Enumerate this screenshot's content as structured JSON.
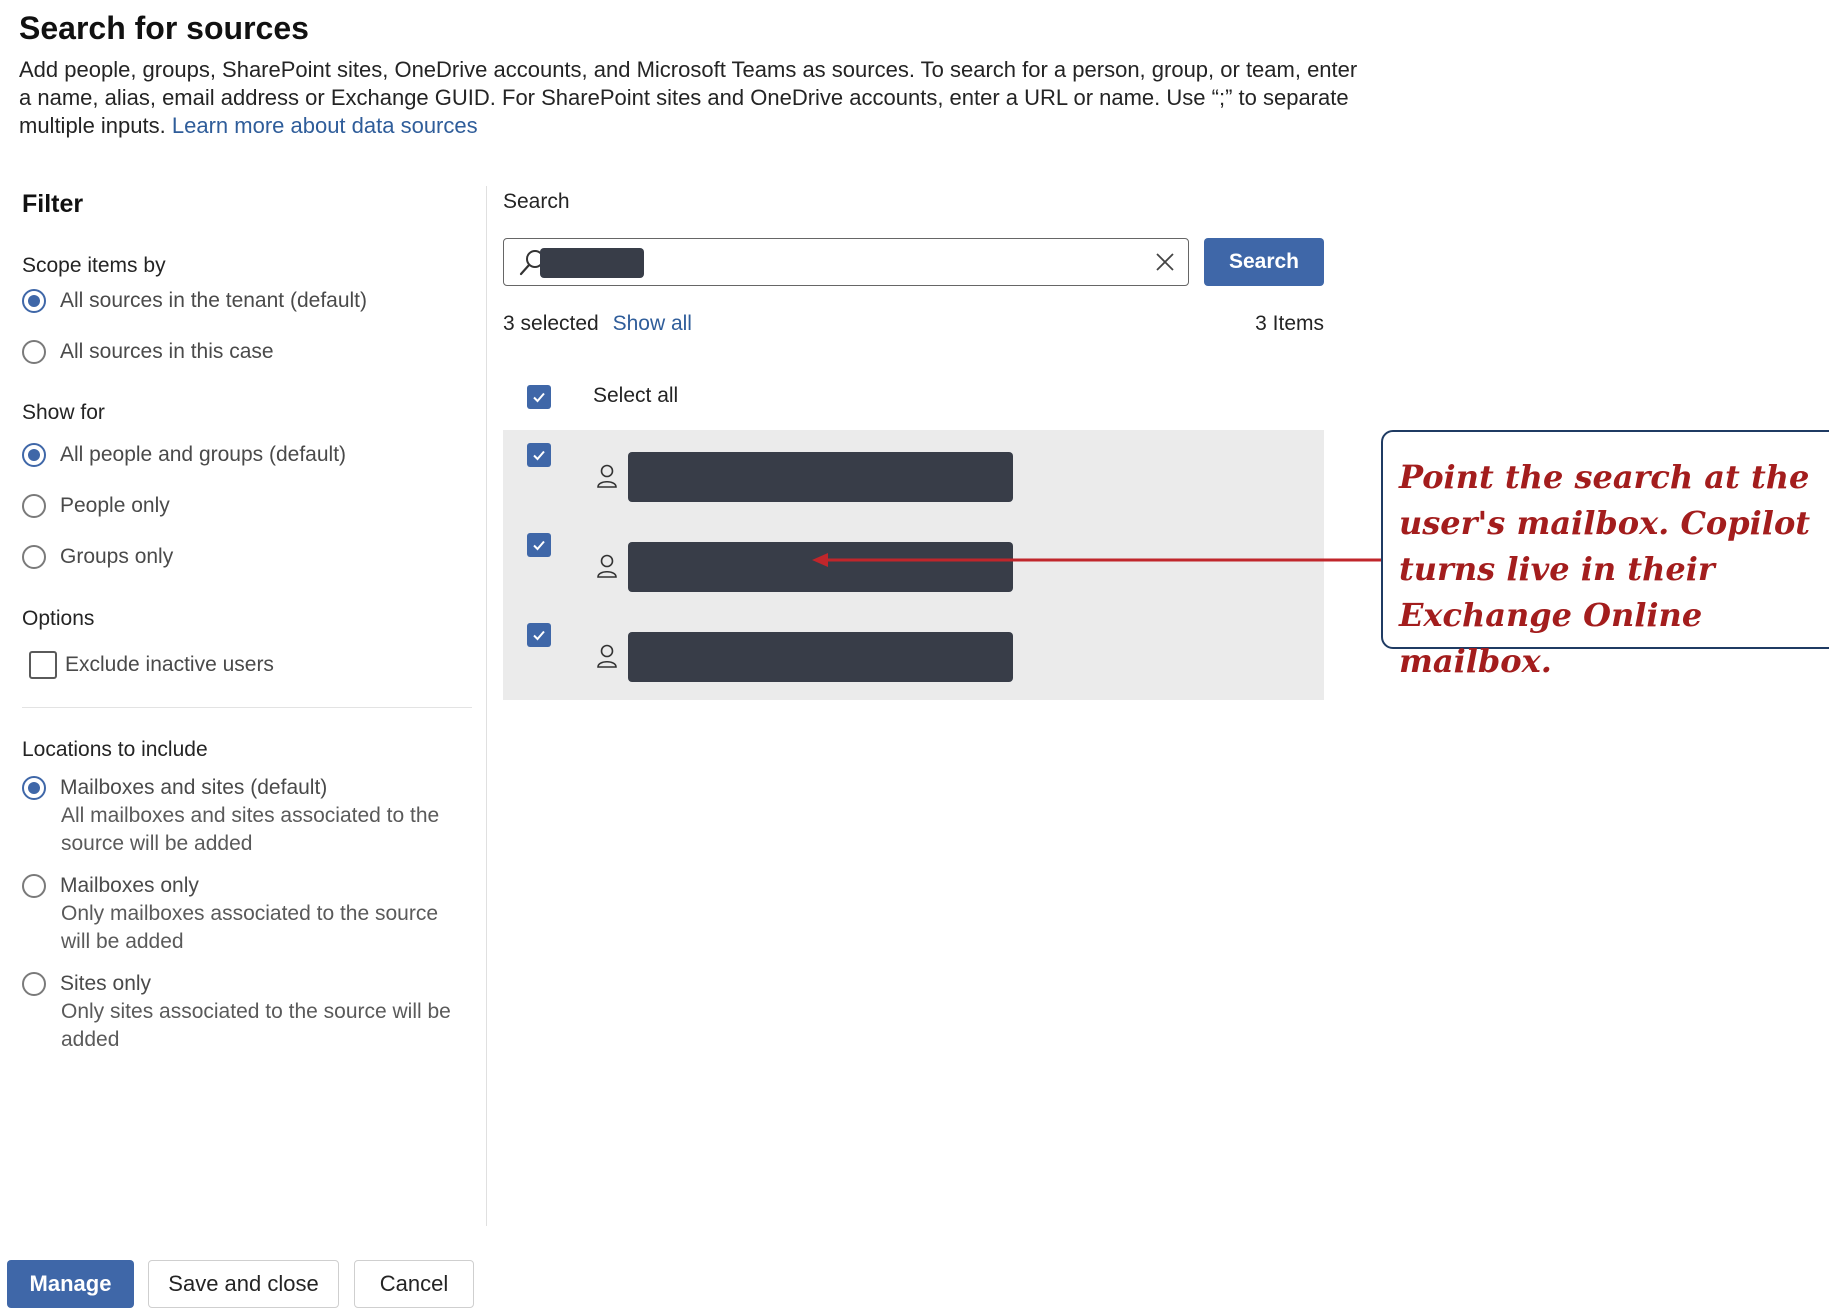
{
  "header": {
    "title": "Search for sources",
    "intro": "Add people, groups, SharePoint sites, OneDrive accounts, and Microsoft Teams as sources. To search for a person, group, or team, enter a name, alias, email address or Exchange GUID. For SharePoint sites and OneDrive accounts, enter a URL or name. Use “;” to separate multiple inputs.",
    "learn_more_link": "Learn more about data sources"
  },
  "filter": {
    "heading": "Filter",
    "scope": {
      "heading": "Scope items by",
      "options": [
        {
          "label": "All sources in the tenant (default)",
          "selected": true
        },
        {
          "label": "All sources in this case",
          "selected": false
        }
      ]
    },
    "show_for": {
      "heading": "Show for",
      "options": [
        {
          "label": "All people and groups (default)",
          "selected": true
        },
        {
          "label": "People only",
          "selected": false
        },
        {
          "label": "Groups only",
          "selected": false
        }
      ]
    },
    "options": {
      "heading": "Options",
      "exclude_inactive_label": "Exclude inactive users",
      "exclude_inactive_checked": false
    },
    "locations": {
      "heading": "Locations to include",
      "options": [
        {
          "label": "Mailboxes and sites (default)",
          "description": "All mailboxes and sites associated to the source will be added",
          "selected": true
        },
        {
          "label": "Mailboxes only",
          "description": "Only mailboxes associated to the source will be added",
          "selected": false
        },
        {
          "label": "Sites only",
          "description": "Only sites associated to the source will be added",
          "selected": false
        }
      ]
    }
  },
  "search": {
    "label": "Search",
    "button_label": "Search",
    "selected_text": "3 selected",
    "show_all_link": "Show all",
    "items_count": "3 Items",
    "select_all_label": "Select all",
    "results": [
      {
        "checked": true
      },
      {
        "checked": true
      },
      {
        "checked": true
      }
    ]
  },
  "annotation": {
    "text": "Point the search at the user's mailbox. Copilot turns live in their Exchange Online mailbox.",
    "color": "#a31d1d",
    "border_color": "#1f3b63"
  },
  "footer": {
    "manage_label": "Manage",
    "save_close_label": "Save and close",
    "cancel_label": "Cancel"
  },
  "colors": {
    "accent": "#3f67a8",
    "link": "#2f5d9a",
    "redaction": "#383d48",
    "results_bg": "#ebebeb"
  }
}
